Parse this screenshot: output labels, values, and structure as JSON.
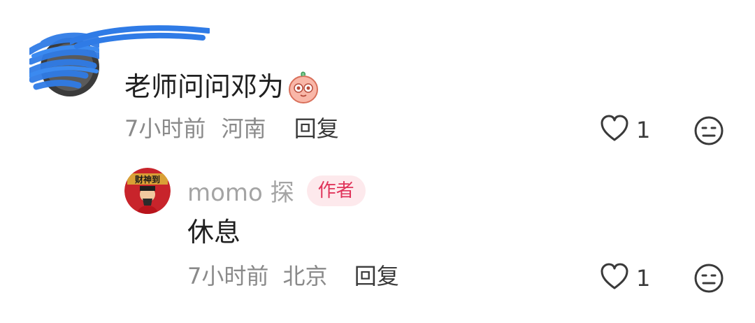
{
  "comment": {
    "text": "老师问问邓为",
    "emoji": "peach-face-emoji",
    "time": "7小时前",
    "location": "河南",
    "reply_label": "回复",
    "likes": "1"
  },
  "reply": {
    "username": "momo 探",
    "badge": "作者",
    "text": "休息",
    "time": "7小时前",
    "location": "北京",
    "reply_label": "回复",
    "likes": "1"
  },
  "colors": {
    "badge_bg": "#fde9ec",
    "badge_text": "#e0345a",
    "meta_text": "#8a8a8a",
    "scribble": "#2f7be6"
  }
}
